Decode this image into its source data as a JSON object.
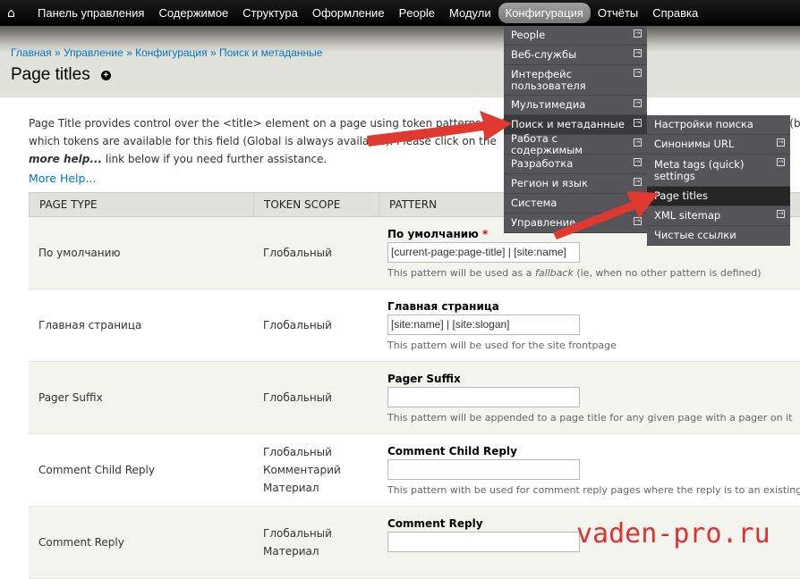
{
  "topbar": {
    "items": [
      "Панель управления",
      "Содержимое",
      "Структура",
      "Оформление",
      "People",
      "Модули",
      "Конфигурация",
      "Отчёты",
      "Справка"
    ],
    "active": "Конфигурация"
  },
  "breadcrumb": [
    "Главная",
    "Управление",
    "Конфигурация",
    "Поиск и метаданные"
  ],
  "page_title": "Page titles",
  "intro": {
    "line1": "Page Title provides control over the <title> element on a page using token patterns and an optional textfield to override the title of the item (be it a n",
    "line2_a": "which tokens are available for this field (Global is always available). Please click on the ",
    "line2_b": "more help...",
    "line2_c": " link below if you need further assistance."
  },
  "more_help": "More Help...",
  "table": {
    "headers": [
      "Page type",
      "Token scope",
      "Pattern"
    ],
    "rows": [
      {
        "type": "По умолчанию",
        "scopes": [
          "Глобальный"
        ],
        "label": "По умолчанию",
        "required": "*",
        "value": "[current-page:page-title] | [site:name]",
        "desc_a": "This pattern will be used as a ",
        "desc_em": "fallback",
        "desc_b": " (ie, when no other pattern is defined)"
      },
      {
        "type": "Главная страница",
        "scopes": [
          "Глобальный"
        ],
        "label": "Главная страница",
        "value": "[site:name] | [site:slogan]",
        "desc_a": "This pattern will be used for the site frontpage"
      },
      {
        "type": "Pager Suffix",
        "scopes": [
          "Глобальный"
        ],
        "label": "Pager Suffix",
        "value": "",
        "desc_a": "This pattern will be appended to a page title for any given page with a pager on it"
      },
      {
        "type": "Comment Child Reply",
        "scopes": [
          "Глобальный",
          "Комментарий",
          "Материал"
        ],
        "label": "Comment Child Reply",
        "value": "",
        "desc_a": "This pattern with be used for comment reply pages where the reply is to an existing \"c"
      },
      {
        "type": "Comment Reply",
        "scopes": [
          "Глобальный",
          "Материал"
        ],
        "label": "Comment Reply",
        "value": "",
        "desc_a": ""
      }
    ]
  },
  "menu": [
    "People",
    "Веб-службы",
    "Интерфейс пользователя",
    "Мультимедиа",
    "Поиск и метаданные",
    "Работа с содержимым",
    "Разработка",
    "Регион и язык",
    "Система",
    "Управление"
  ],
  "submenu": [
    "Настройки поиска",
    "Синонимы URL",
    "Meta tags (quick) settings",
    "Page titles",
    "XML sitemap",
    "Чистые ссылки"
  ],
  "watermark": "vaden-pro.ru",
  "colors": {
    "link": "#0074bd",
    "arrow": "#e03a30",
    "menu_bg": "#56555a"
  }
}
